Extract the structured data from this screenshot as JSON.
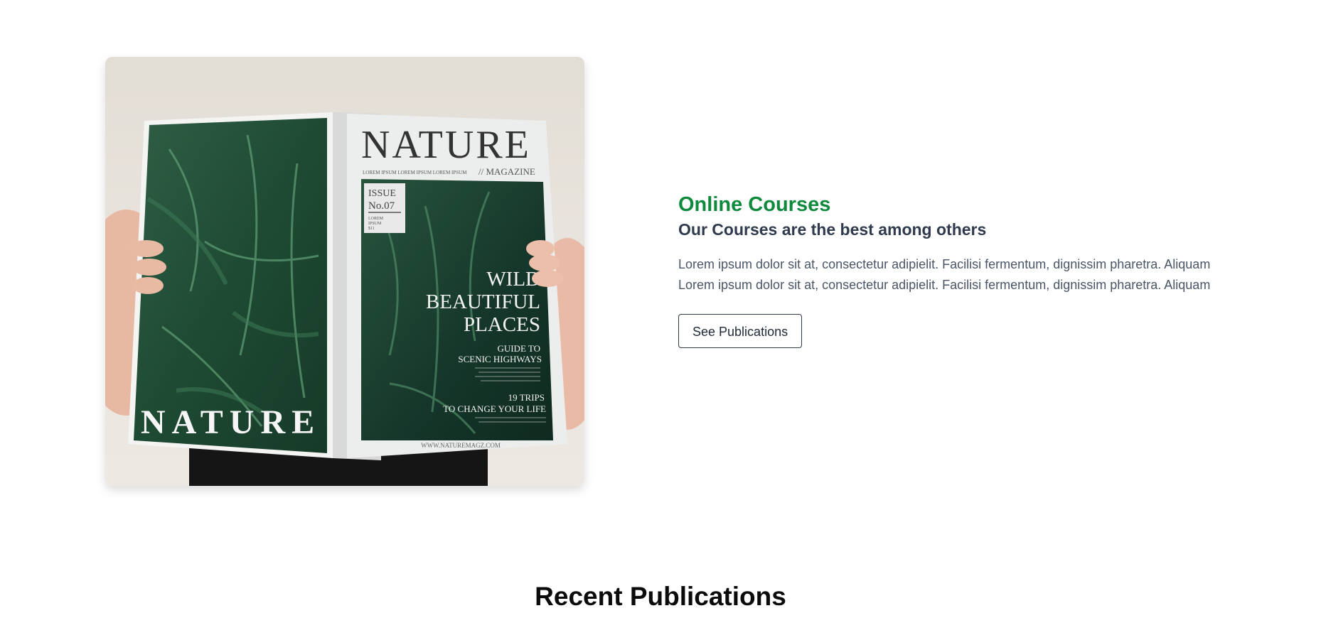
{
  "hero": {
    "image": {
      "alt": "Person holding an open Nature magazine",
      "cover_title": "NATURE",
      "cover_tagline": "LOREM IPSUM LOREM IPSUM LOREM IPSUM",
      "cover_magazine": "// MAGAZINE",
      "issue_label": "ISSUE",
      "issue_number": "No.07",
      "issue_small": "LOREM",
      "issue_small2": "IPSUM",
      "issue_price": "$11",
      "headline_1": "WILD",
      "headline_2": "BEAUTIFUL",
      "headline_3": "PLACES",
      "guide_1": "GUIDE TO",
      "guide_2": "SCENIC HIGHWAYS",
      "trips_1": "19 TRIPS",
      "trips_2": "TO CHANGE YOUR LIFE",
      "website": "WWW.NATUREMAGZ.COM",
      "back_title": "NATURE"
    },
    "kicker": "Online Courses",
    "subtitle": "Our Courses are the best among others",
    "paragraph_line1": "Lorem ipsum dolor sit at, consectetur adipielit. Facilisi fermentum, dignissim pharetra. Aliquam",
    "paragraph_line2": "Lorem ipsum dolor sit at, consectetur adipielit. Facilisi fermentum, dignissim pharetra. Aliquam",
    "button_label": "See Publications"
  },
  "recent": {
    "title": "Recent Publications"
  },
  "colors": {
    "accent_green": "#0f8a3c",
    "heading_dark": "#2f3a4c"
  }
}
